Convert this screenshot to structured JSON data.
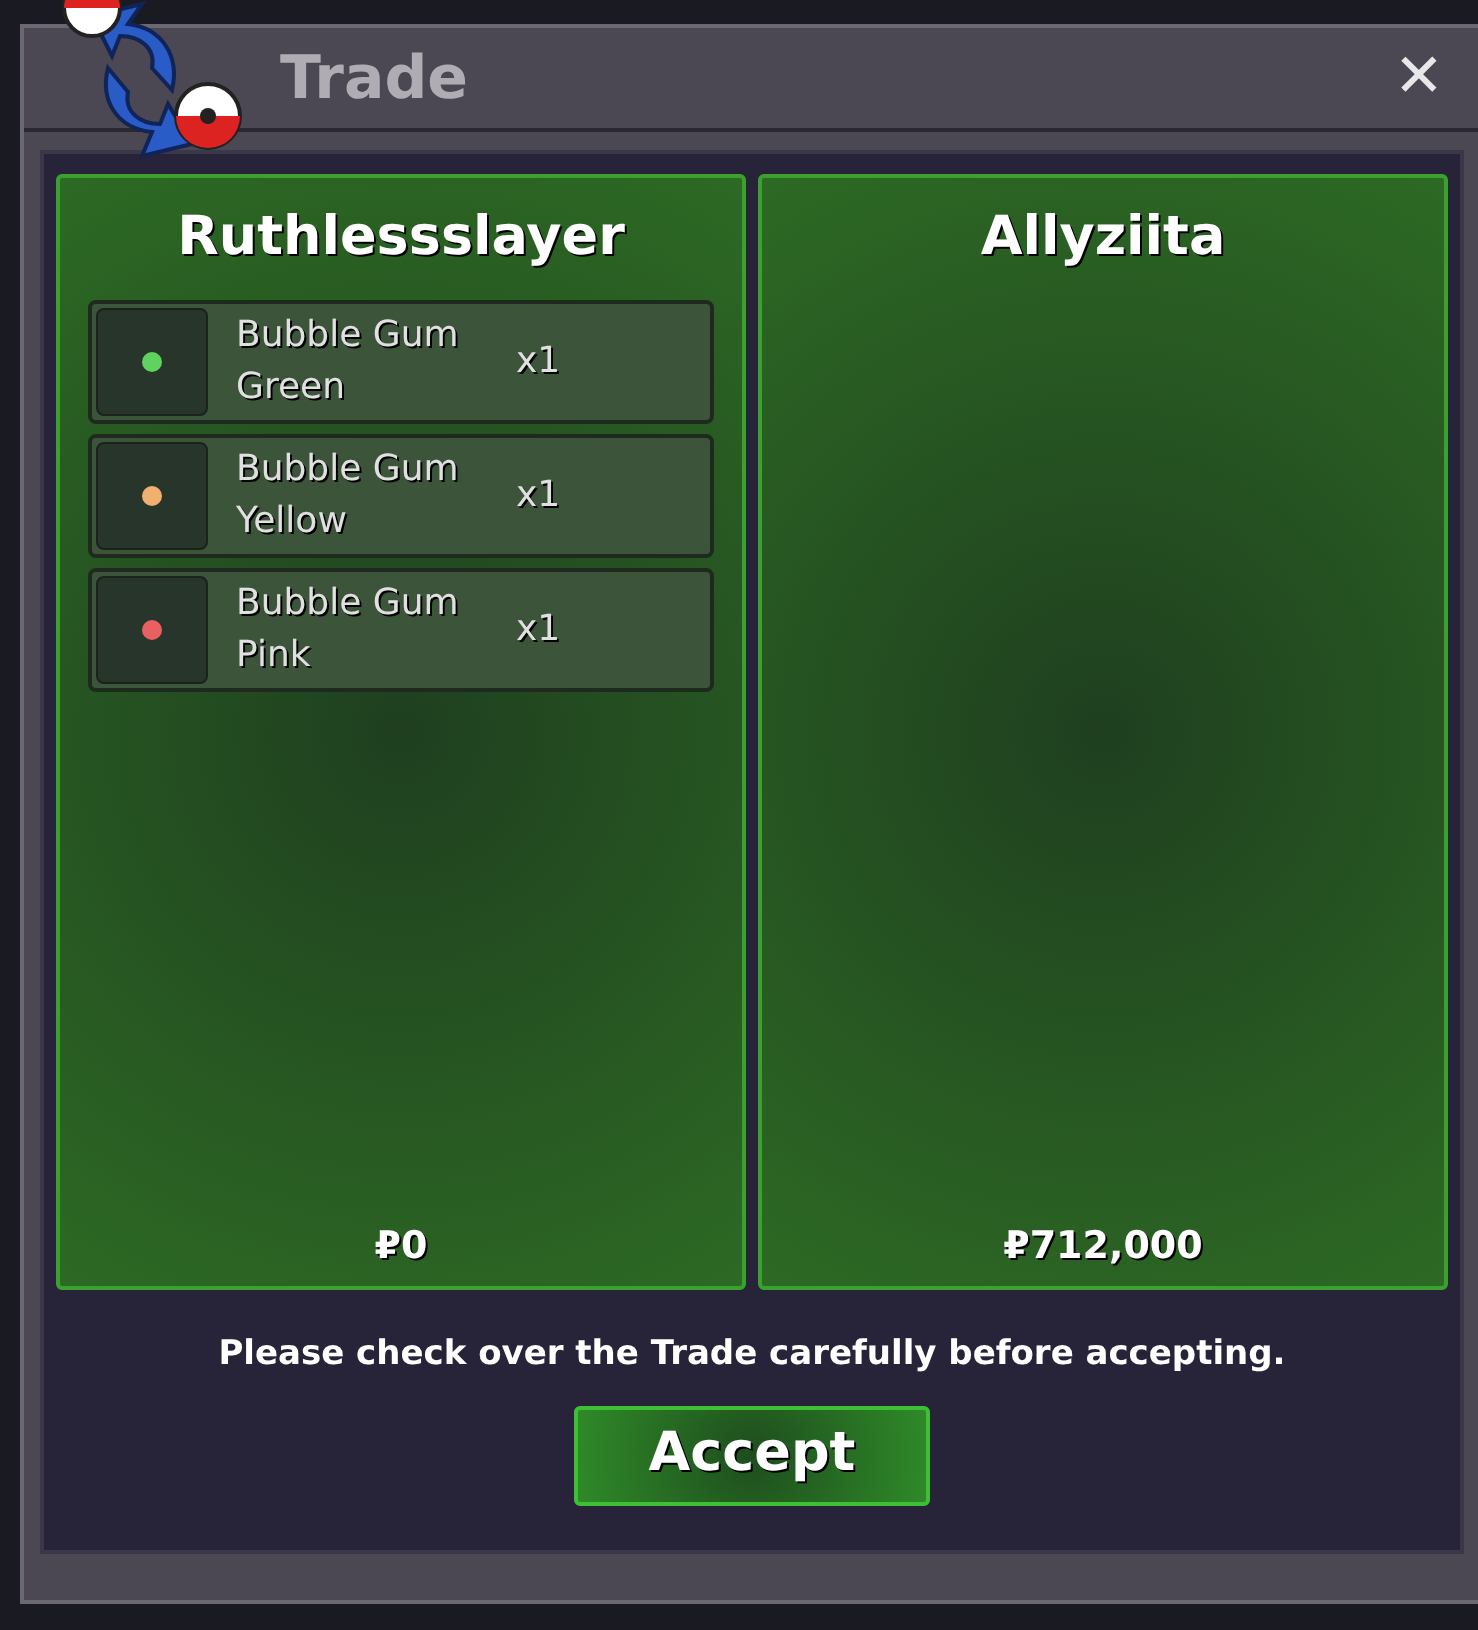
{
  "window": {
    "title": "Trade",
    "close": "✕"
  },
  "panels": [
    {
      "player": "Ruthlessslayer",
      "items": [
        {
          "name": "Bubble Gum Green",
          "quantity": "x1",
          "color": "#5fd35f"
        },
        {
          "name": "Bubble Gum Yellow",
          "quantity": "x1",
          "color": "#f0b070"
        },
        {
          "name": "Bubble Gum Pink",
          "quantity": "x1",
          "color": "#e86060"
        }
      ],
      "money": "₽0"
    },
    {
      "player": "Allyziita",
      "money": "₽712,000"
    }
  ],
  "notice": "Please check over the Trade carefully before accepting.",
  "accept_button": "Accept"
}
